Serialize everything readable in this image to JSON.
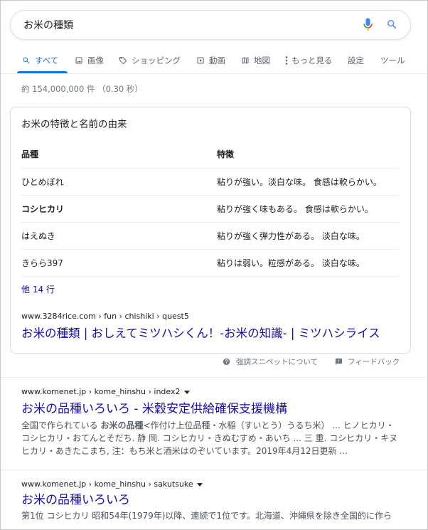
{
  "colors": {
    "link": "#1a0dab",
    "accent": "#1a73e8",
    "text": "#202124",
    "muted": "#70757a",
    "snippet_text": "#4d5156",
    "border": "#dadce0"
  },
  "search": {
    "query": "お米の種類",
    "icons": [
      "mic-icon",
      "search-icon"
    ]
  },
  "tabs": [
    {
      "label": "すべて",
      "icon": "search-icon",
      "active": true
    },
    {
      "label": "画像",
      "icon": "image-icon"
    },
    {
      "label": "ショッピング",
      "icon": "tag-icon"
    },
    {
      "label": "動画",
      "icon": "play-icon"
    },
    {
      "label": "地図",
      "icon": "map-icon"
    },
    {
      "label": "もっと見る",
      "icon": "more-vert-icon"
    },
    {
      "label": "設定"
    },
    {
      "label": "ツール"
    }
  ],
  "stats": "約 154,000,000 件 （0.30 秒）",
  "featured_snippet": {
    "title": "お米の特徴と名前の由来",
    "table": {
      "headers": [
        "品種",
        "特徴"
      ],
      "rows": [
        [
          "ひとめぼれ",
          "粘りが強い。淡白な味。 食感は軟らかい。"
        ],
        [
          "コシヒカリ",
          "粘りが強く味もある。 食感は軟らかい。"
        ],
        [
          "はえぬき",
          "粘りが強く弾力性がある。 淡白な味。"
        ],
        [
          "きらら397",
          "粘りは弱い。粒感がある。 淡白な味。"
        ]
      ]
    },
    "more_rows": "他 14 行",
    "url": "www.3284rice.com › fun › chishiki › quest5",
    "link_title": "お米の種類 | おしえてミツハシくん！-お米の知識- | ミツハシライス"
  },
  "snippet_feedback": {
    "about": "強調スニペットについて",
    "feedback": "フィードバック",
    "icons": [
      "help-icon",
      "feedback-icon"
    ]
  },
  "results": [
    {
      "url": "www.komenet.jp › kome_hinshu › index2",
      "title": "お米の品種いろいろ - 米穀安定供給確保支援機構",
      "snippet": {
        "pre": "全国で作られている ",
        "highlight": "お米の品種",
        "post": "<作付け上位品種・水稲（すいとう）うるち米） ... ヒノヒカリ・コシヒカリ・おてんとそだち. 静 岡. コシヒカリ・きぬむすめ・あいち ... 三 重. コシヒカリ・キヌヒカリ・あきたこまち, 注：もち米と酒米はのぞいています。2019年4月12日更新 ..."
      }
    },
    {
      "url": "www.komenet.jp › kome_hinshu › sakutsuke",
      "title": "お米の品種いろいろ",
      "snippet": {
        "text": "第1位 コシヒカリ 昭和54年(1979年)以降、連続で1位です。北海道、沖縄県を除き全国的に作ら"
      }
    }
  ]
}
